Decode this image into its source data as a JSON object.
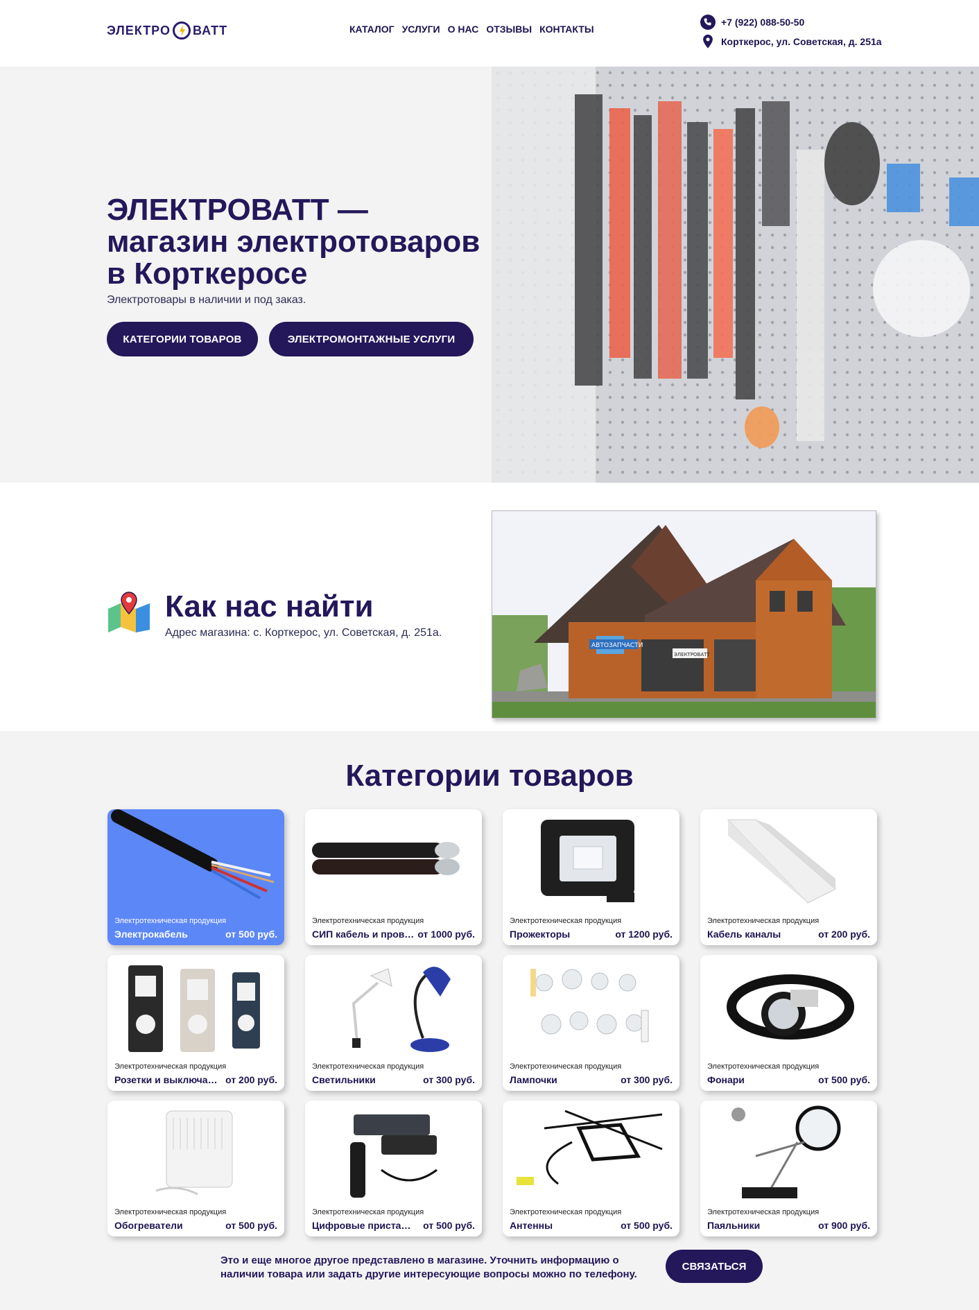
{
  "header": {
    "logo_left": "ЭЛЕКТРО",
    "logo_right": "ВАТТ",
    "nav": [
      "КАТАЛОГ",
      "УСЛУГИ",
      "О НАС",
      "ОТЗЫВЫ",
      "КОНТАКТЫ"
    ],
    "phone": "+7 (922) 088-50-50",
    "address": "Корткерос, ул. Советская, д. 251а"
  },
  "hero": {
    "title": "ЭЛЕКТРОВАТТ — магазин электротоваров в Корткеросе",
    "subtitle": "Электротовары в наличии и под заказ.",
    "btn_categories": "КАТЕГОРИИ ТОВАРОВ",
    "btn_services": "ЭЛЕКТРОМОНТАЖНЫЕ УСЛУГИ"
  },
  "find": {
    "title": "Как нас найти",
    "address": "Адрес магазина: с. Корткерос, ул. Советская, д. 251а.",
    "sign_1": "АВТОЗАПЧАСТИ",
    "sign_2": "ЭЛЕКТРОВАТТ"
  },
  "categories": {
    "title": "Категории товаров",
    "items": [
      {
        "sub": "Электротехническая продукция",
        "name": "Электрокабель",
        "price": "от 500 руб."
      },
      {
        "sub": "Электротехническая продукция",
        "name": "СИП кабель и провод",
        "price": "от 1000 руб."
      },
      {
        "sub": "Электротехническая продукция",
        "name": "Прожекторы",
        "price": "от 1200 руб."
      },
      {
        "sub": "Электротехническая продукция",
        "name": "Кабель каналы",
        "price": "от 200 руб."
      },
      {
        "sub": "Электротехническая продукция",
        "name": "Розетки и выключат...",
        "price": "от 200 руб."
      },
      {
        "sub": "Электротехническая продукция",
        "name": "Светильники",
        "price": "от 300 руб."
      },
      {
        "sub": "Электротехническая продукция",
        "name": "Лампочки",
        "price": "от 300 руб."
      },
      {
        "sub": "Электротехническая продукция",
        "name": "Фонари",
        "price": "от 500 руб."
      },
      {
        "sub": "Электротехническая продукция",
        "name": "Обогреватели",
        "price": "от 500 руб."
      },
      {
        "sub": "Электротехническая продукция",
        "name": "Цифровые приставки",
        "price": "от 500 руб."
      },
      {
        "sub": "Электротехническая продукция",
        "name": "Антенны",
        "price": "от 500 руб."
      },
      {
        "sub": "Электротехническая продукция",
        "name": "Паяльники",
        "price": "от 900 руб."
      }
    ],
    "note": "Это и еще многое другое представлено в магазине. Уточнить информацию о наличии товара или задать другие интересующие вопросы можно по телефону.",
    "btn_contact": "СВЯЗАТЬСЯ"
  },
  "colors": {
    "brand": "#24175a",
    "accent": "#5c87f7",
    "logo_bolt": "#f4b400"
  }
}
